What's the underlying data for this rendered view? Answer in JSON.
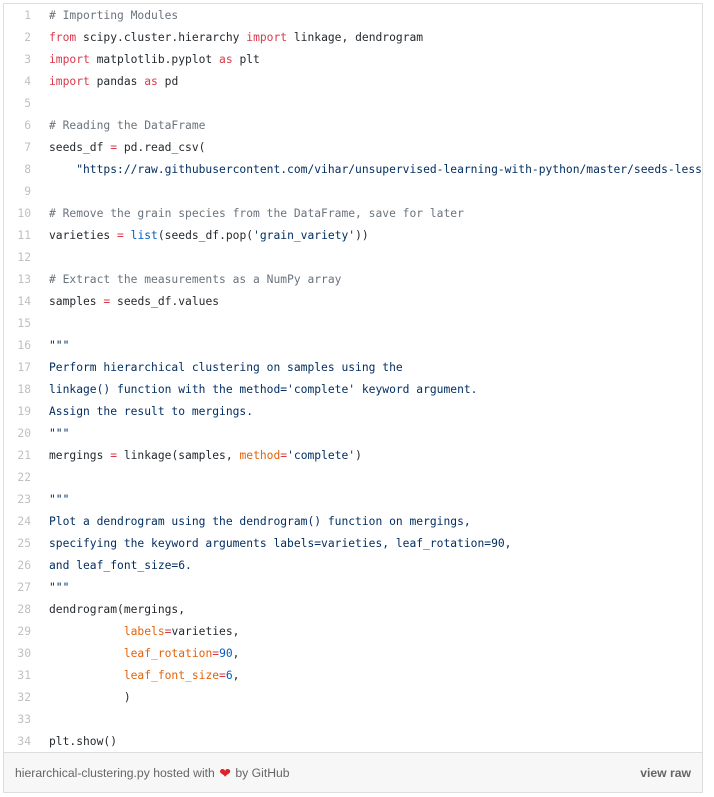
{
  "gist": {
    "lines": [
      [
        {
          "t": "c",
          "v": "# Importing Modules"
        }
      ],
      [
        {
          "t": "k",
          "v": "from"
        },
        {
          "t": "p",
          "v": " scipy.cluster.hierarchy "
        },
        {
          "t": "k",
          "v": "import"
        },
        {
          "t": "p",
          "v": " linkage, dendrogram"
        }
      ],
      [
        {
          "t": "k",
          "v": "import"
        },
        {
          "t": "p",
          "v": " matplotlib.pyplot "
        },
        {
          "t": "k",
          "v": "as"
        },
        {
          "t": "p",
          "v": " plt"
        }
      ],
      [
        {
          "t": "k",
          "v": "import"
        },
        {
          "t": "p",
          "v": " pandas "
        },
        {
          "t": "k",
          "v": "as"
        },
        {
          "t": "p",
          "v": " pd"
        }
      ],
      [],
      [
        {
          "t": "c",
          "v": "# Reading the DataFrame"
        }
      ],
      [
        {
          "t": "p",
          "v": "seeds_df "
        },
        {
          "t": "k",
          "v": "="
        },
        {
          "t": "p",
          "v": " pd.read_csv("
        }
      ],
      [
        {
          "t": "s",
          "v": "    \"https://raw.githubusercontent.com/vihar/unsupervised-learning-with-python/master/seeds-less-rows.csv\")"
        }
      ],
      [],
      [
        {
          "t": "c",
          "v": "# Remove the grain species from the DataFrame, save for later"
        }
      ],
      [
        {
          "t": "p",
          "v": "varieties "
        },
        {
          "t": "k",
          "v": "="
        },
        {
          "t": "p",
          "v": " "
        },
        {
          "t": "n",
          "v": "list"
        },
        {
          "t": "p",
          "v": "(seeds_df.pop("
        },
        {
          "t": "s",
          "v": "'grain_variety'"
        },
        {
          "t": "p",
          "v": "))"
        }
      ],
      [],
      [
        {
          "t": "c",
          "v": "# Extract the measurements as a NumPy array"
        }
      ],
      [
        {
          "t": "p",
          "v": "samples "
        },
        {
          "t": "k",
          "v": "="
        },
        {
          "t": "p",
          "v": " seeds_df.values"
        }
      ],
      [],
      [
        {
          "t": "s",
          "v": "\"\"\""
        }
      ],
      [
        {
          "t": "s",
          "v": "Perform hierarchical clustering on samples using the"
        }
      ],
      [
        {
          "t": "s",
          "v": "linkage() function with the method='complete' keyword argument."
        }
      ],
      [
        {
          "t": "s",
          "v": "Assign the result to mergings."
        }
      ],
      [
        {
          "t": "s",
          "v": "\"\"\""
        }
      ],
      [
        {
          "t": "p",
          "v": "mergings "
        },
        {
          "t": "k",
          "v": "="
        },
        {
          "t": "p",
          "v": " linkage(samples, "
        },
        {
          "t": "v",
          "v": "method"
        },
        {
          "t": "k",
          "v": "="
        },
        {
          "t": "s",
          "v": "'complete'"
        },
        {
          "t": "p",
          "v": ")"
        }
      ],
      [],
      [
        {
          "t": "s",
          "v": "\"\"\""
        }
      ],
      [
        {
          "t": "s",
          "v": "Plot a dendrogram using the dendrogram() function on mergings,"
        }
      ],
      [
        {
          "t": "s",
          "v": "specifying the keyword arguments labels=varieties, leaf_rotation=90,"
        }
      ],
      [
        {
          "t": "s",
          "v": "and leaf_font_size=6."
        }
      ],
      [
        {
          "t": "s",
          "v": "\"\"\""
        }
      ],
      [
        {
          "t": "p",
          "v": "dendrogram(mergings,"
        }
      ],
      [
        {
          "t": "p",
          "v": "           "
        },
        {
          "t": "v",
          "v": "labels"
        },
        {
          "t": "k",
          "v": "="
        },
        {
          "t": "p",
          "v": "varieties,"
        }
      ],
      [
        {
          "t": "p",
          "v": "           "
        },
        {
          "t": "v",
          "v": "leaf_rotation"
        },
        {
          "t": "k",
          "v": "="
        },
        {
          "t": "n",
          "v": "90"
        },
        {
          "t": "p",
          "v": ","
        }
      ],
      [
        {
          "t": "p",
          "v": "           "
        },
        {
          "t": "v",
          "v": "leaf_font_size"
        },
        {
          "t": "k",
          "v": "="
        },
        {
          "t": "n",
          "v": "6"
        },
        {
          "t": "p",
          "v": ","
        }
      ],
      [
        {
          "t": "p",
          "v": "           )"
        }
      ],
      [],
      [
        {
          "t": "p",
          "v": "plt.show()"
        }
      ]
    ]
  },
  "footer": {
    "filename": "hierarchical-clustering.py",
    "hosted_with": "hosted with",
    "heart_icon": "heart-icon",
    "by": "by",
    "github": "GitHub",
    "view_raw": "view raw"
  }
}
